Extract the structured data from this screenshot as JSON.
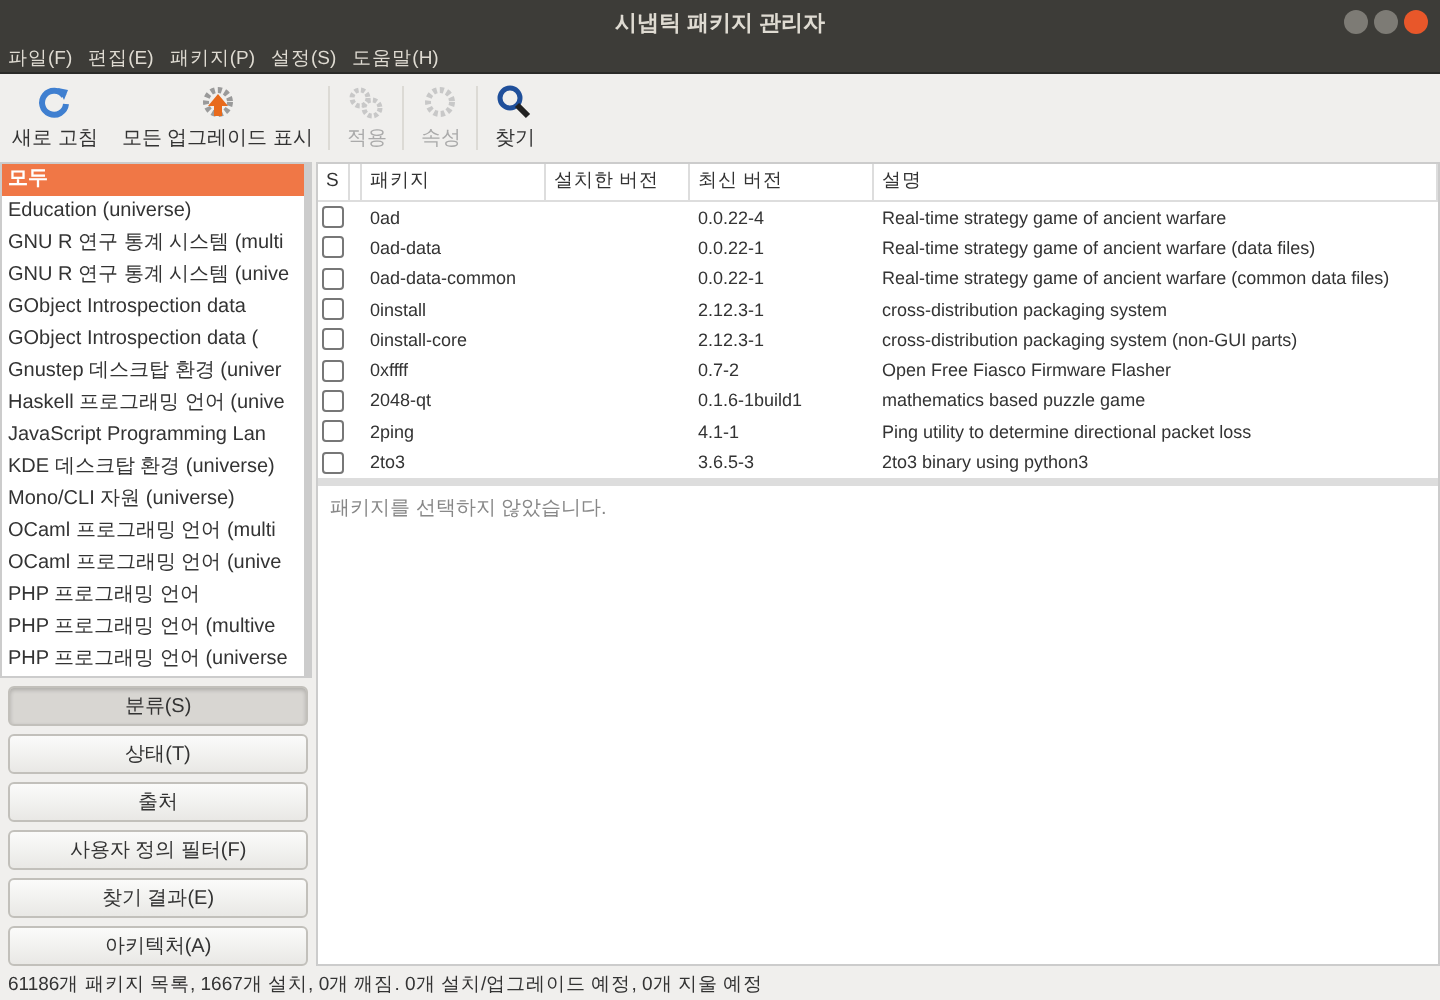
{
  "window": {
    "title": "시냅틱 패키지 관리자"
  },
  "menu": [
    "파일(F)",
    "편집(E)",
    "패키지(P)",
    "설정(S)",
    "도움말(H)"
  ],
  "toolbar": [
    {
      "kind": "refresh",
      "label": "새로 고침",
      "disabled": false
    },
    {
      "kind": "upgrade",
      "label": "모든 업그레이드 표시",
      "disabled": false
    },
    {
      "kind": "apply",
      "label": "적용",
      "disabled": true
    },
    {
      "kind": "properties",
      "label": "속성",
      "disabled": true
    },
    {
      "kind": "search",
      "label": "찾기",
      "disabled": false
    }
  ],
  "sidebar": {
    "items": [
      {
        "label": "모두",
        "selected": true
      },
      {
        "label": "Education (universe)",
        "selected": false
      },
      {
        "label": "GNU R 연구 통계 시스템 (multi",
        "selected": false
      },
      {
        "label": "GNU R 연구 통계 시스템 (unive",
        "selected": false
      },
      {
        "label": "GObject Introspection data",
        "selected": false
      },
      {
        "label": "GObject Introspection data (",
        "selected": false
      },
      {
        "label": "Gnustep 데스크탑 환경 (univer",
        "selected": false
      },
      {
        "label": "Haskell 프로그래밍 언어 (unive",
        "selected": false
      },
      {
        "label": "JavaScript Programming Lan",
        "selected": false
      },
      {
        "label": "KDE 데스크탑 환경 (universe)",
        "selected": false
      },
      {
        "label": "Mono/CLI 자원 (universe)",
        "selected": false
      },
      {
        "label": "OCaml 프로그래밍 언어 (multi",
        "selected": false
      },
      {
        "label": "OCaml 프로그래밍 언어 (unive",
        "selected": false
      },
      {
        "label": "PHP 프로그래밍 언어",
        "selected": false
      },
      {
        "label": "PHP 프로그래밍 언어 (multive",
        "selected": false
      },
      {
        "label": "PHP 프로그래밍 언어 (universe",
        "selected": false
      }
    ],
    "filters": [
      {
        "label": "분류(S)",
        "selected": true
      },
      {
        "label": "상태(T)",
        "selected": false
      },
      {
        "label": "출처",
        "selected": false
      },
      {
        "label": "사용자 정의 필터(F)",
        "selected": false
      },
      {
        "label": "찾기 결과(E)",
        "selected": false
      },
      {
        "label": "아키텍처(A)",
        "selected": false
      }
    ]
  },
  "table": {
    "columns": [
      "S",
      "패키지",
      "설치한 버전",
      "최신 버전",
      "설명"
    ],
    "rows": [
      {
        "checked": false,
        "package": "0ad",
        "latest": "0.0.22-4",
        "description": "Real-time strategy game of ancient warfare"
      },
      {
        "checked": false,
        "package": "0ad-data",
        "latest": "0.0.22-1",
        "description": "Real-time strategy game of ancient warfare (data files)"
      },
      {
        "checked": false,
        "package": "0ad-data-common",
        "latest": "0.0.22-1",
        "description": "Real-time strategy game of ancient warfare (common data files)"
      },
      {
        "checked": false,
        "package": "0install",
        "latest": "2.12.3-1",
        "description": "cross-distribution packaging system"
      },
      {
        "checked": false,
        "package": "0install-core",
        "latest": "2.12.3-1",
        "description": "cross-distribution packaging system (non-GUI parts)"
      },
      {
        "checked": false,
        "package": "0xffff",
        "latest": "0.7-2",
        "description": "Open Free Fiasco Firmware Flasher"
      },
      {
        "checked": false,
        "package": "2048-qt",
        "latest": "0.1.6-1build1",
        "description": "mathematics based puzzle game"
      },
      {
        "checked": false,
        "package": "2ping",
        "latest": "4.1-1",
        "description": "Ping utility to determine directional packet loss"
      },
      {
        "checked": false,
        "package": "2to3",
        "latest": "3.6.5-3",
        "description": "2to3 binary using python3"
      }
    ]
  },
  "details": {
    "placeholder": "패키지를 선택하지 않았습니다."
  },
  "status_bar": "61186개 패키지 목록, 1667개 설치, 0개 깨짐. 0개 설치/업그레이드 예정, 0개 지울 예정"
}
